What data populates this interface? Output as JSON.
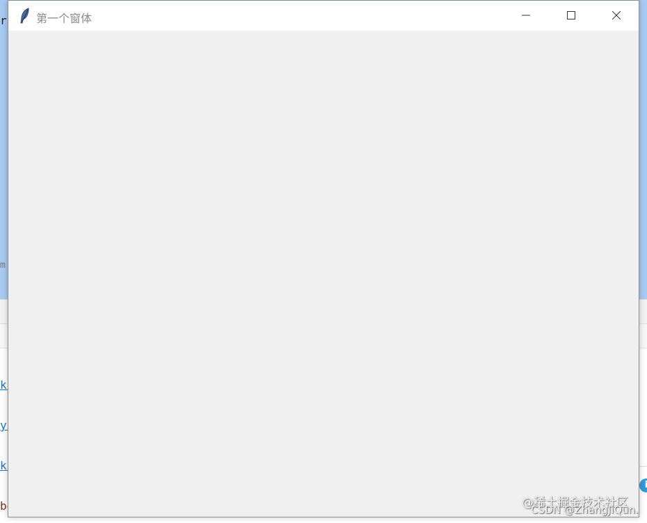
{
  "window": {
    "title": "第一个窗体",
    "controls": {
      "minimize_icon": "minimize-icon",
      "maximize_icon": "maximize-icon",
      "close_icon": "close-icon"
    },
    "title_icon": "feather-icon"
  },
  "background": {
    "fragments": [
      "r",
      "m",
      "k:",
      "y'",
      "k:",
      "bo"
    ],
    "accent": "#a8cbf2"
  },
  "watermark": {
    "line1": "@稀土掘金技术社区",
    "line2": "CSDN @ZhangJiQun."
  }
}
